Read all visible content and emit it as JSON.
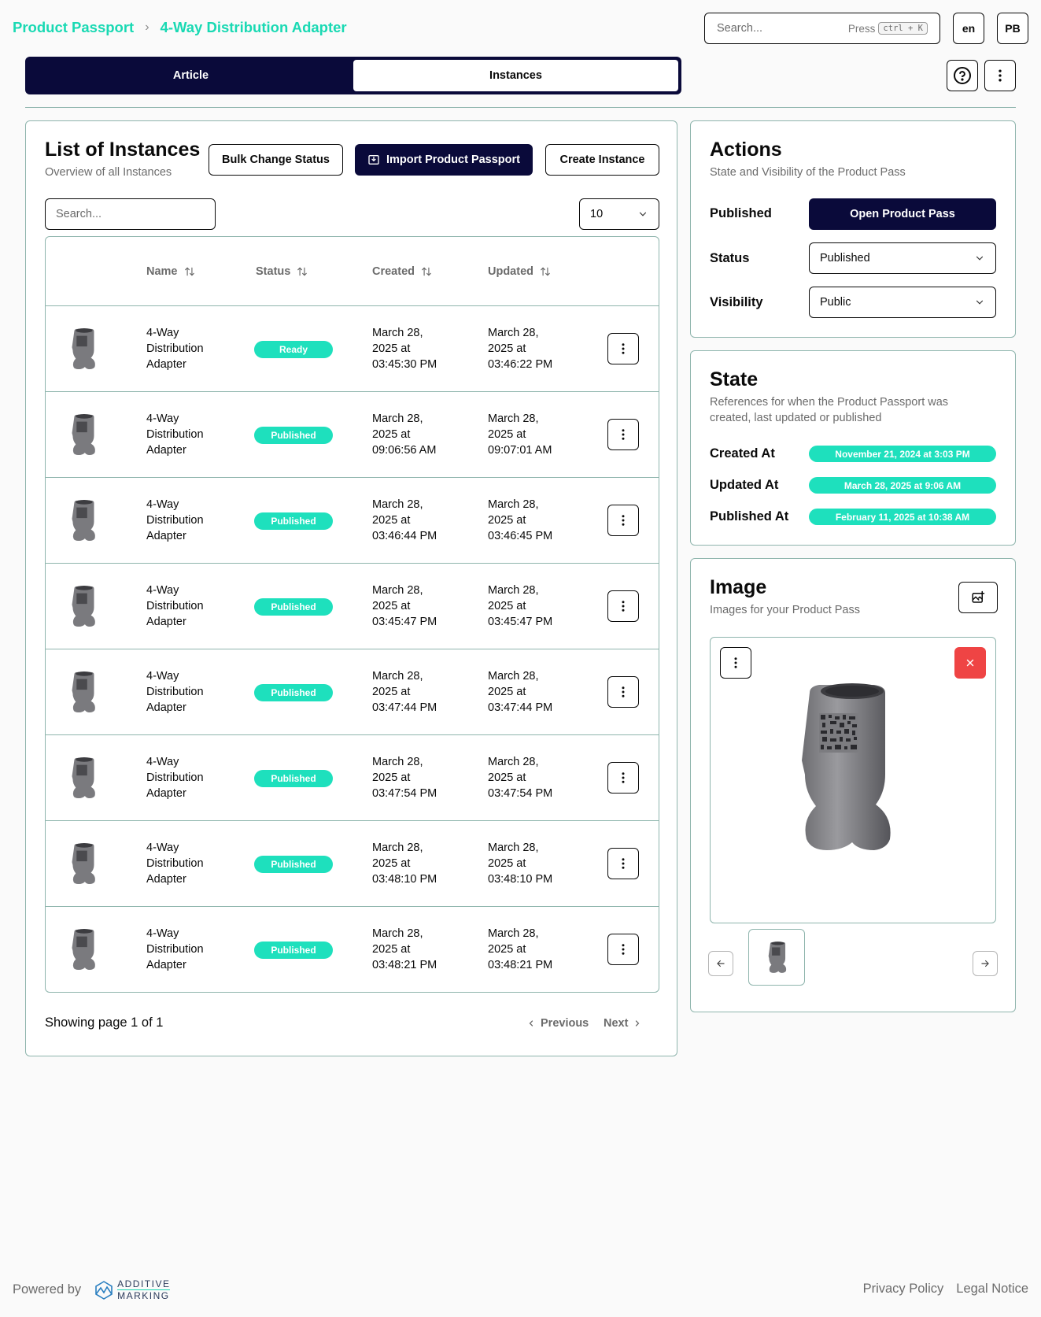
{
  "breadcrumb": {
    "root": "Product Passport",
    "separator": "›",
    "current": "4-Way Distribution Adapter"
  },
  "header": {
    "search_placeholder": "Search...",
    "press_label": "Press",
    "shortcut": "ctrl + K",
    "language": "en",
    "user_initials": "PB"
  },
  "tabs": [
    {
      "label": "Article",
      "active": false
    },
    {
      "label": "Instances",
      "active": true
    }
  ],
  "list": {
    "title": "List of Instances",
    "subtitle": "Overview of all Instances",
    "bulk_button": "Bulk Change Status",
    "import_button": "Import Product Passport",
    "create_button": "Create Instance",
    "search_placeholder": "Search...",
    "page_size": "10",
    "columns": {
      "name": "Name",
      "status": "Status",
      "created": "Created",
      "updated": "Updated"
    },
    "rows": [
      {
        "name": [
          "4-Way",
          "Distribution",
          "Adapter"
        ],
        "status": "Ready",
        "created": [
          "March 28,",
          "2025 at",
          "03:45:30 PM"
        ],
        "updated": [
          "March 28,",
          "2025 at",
          "03:46:22 PM"
        ]
      },
      {
        "name": [
          "4-Way",
          "Distribution",
          "Adapter"
        ],
        "status": "Published",
        "created": [
          "March 28,",
          "2025 at",
          "09:06:56 AM"
        ],
        "updated": [
          "March 28,",
          "2025 at",
          "09:07:01 AM"
        ]
      },
      {
        "name": [
          "4-Way",
          "Distribution",
          "Adapter"
        ],
        "status": "Published",
        "created": [
          "March 28,",
          "2025 at",
          "03:46:44 PM"
        ],
        "updated": [
          "March 28,",
          "2025 at",
          "03:46:45 PM"
        ]
      },
      {
        "name": [
          "4-Way",
          "Distribution",
          "Adapter"
        ],
        "status": "Published",
        "created": [
          "March 28,",
          "2025 at",
          "03:45:47 PM"
        ],
        "updated": [
          "March 28,",
          "2025 at",
          "03:45:47 PM"
        ]
      },
      {
        "name": [
          "4-Way",
          "Distribution",
          "Adapter"
        ],
        "status": "Published",
        "created": [
          "March 28,",
          "2025 at",
          "03:47:44 PM"
        ],
        "updated": [
          "March 28,",
          "2025 at",
          "03:47:44 PM"
        ]
      },
      {
        "name": [
          "4-Way",
          "Distribution",
          "Adapter"
        ],
        "status": "Published",
        "created": [
          "March 28,",
          "2025 at",
          "03:47:54 PM"
        ],
        "updated": [
          "March 28,",
          "2025 at",
          "03:47:54 PM"
        ]
      },
      {
        "name": [
          "4-Way",
          "Distribution",
          "Adapter"
        ],
        "status": "Published",
        "created": [
          "March 28,",
          "2025 at",
          "03:48:10 PM"
        ],
        "updated": [
          "March 28,",
          "2025 at",
          "03:48:10 PM"
        ]
      },
      {
        "name": [
          "4-Way",
          "Distribution",
          "Adapter"
        ],
        "status": "Published",
        "created": [
          "March 28,",
          "2025 at",
          "03:48:21 PM"
        ],
        "updated": [
          "March 28,",
          "2025 at",
          "03:48:21 PM"
        ]
      }
    ],
    "pagination": {
      "text": "Showing page 1 of 1",
      "previous": "Previous",
      "next": "Next"
    }
  },
  "actions": {
    "title": "Actions",
    "subtitle": "State and Visibility of the Product Pass",
    "published_label": "Published",
    "open_button": "Open Product Pass",
    "status_label": "Status",
    "status_value": "Published",
    "visibility_label": "Visibility",
    "visibility_value": "Public"
  },
  "state": {
    "title": "State",
    "subtitle_line1": "References for when the Product Passport was",
    "subtitle_line2": "created, last updated or published",
    "created_label": "Created At",
    "created_value": "November 21, 2024 at 3:03 PM",
    "updated_label": "Updated At",
    "updated_value": "March 28, 2025 at 9:06 AM",
    "published_label": "Published At",
    "published_value": "February 11, 2025 at 10:38 AM"
  },
  "image": {
    "title": "Image",
    "subtitle": "Images for your Product Pass"
  },
  "footer": {
    "powered_by": "Powered by",
    "logo_line1": "ADDITIVE",
    "logo_line2": "MARKING",
    "privacy": "Privacy Policy",
    "legal": "Legal Notice"
  },
  "colors": {
    "accent": "#19d9b3",
    "badge": "#1ee0bd",
    "navy": "#0a0a3a",
    "border": "#8fb5ad",
    "danger": "#ef4444"
  },
  "icons": [
    "chevron-right-icon",
    "help-icon",
    "more-vertical-icon",
    "sort-icon",
    "import-icon",
    "chevron-down-icon",
    "image-add-icon",
    "close-icon",
    "arrow-left-icon",
    "arrow-right-icon",
    "chevron-left-icon"
  ]
}
